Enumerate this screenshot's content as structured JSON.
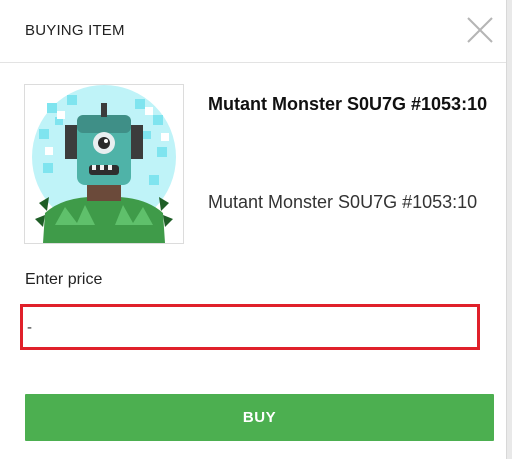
{
  "modal": {
    "title": "BUYING ITEM",
    "close_icon": "close-icon"
  },
  "item": {
    "name": "Mutant Monster S0U7G #1053:10",
    "description": "Mutant Monster S0U7G #1053:10",
    "image_icon": "mutant-monster-image"
  },
  "price": {
    "label": "Enter price",
    "value": "-"
  },
  "actions": {
    "buy_label": "BUY"
  },
  "colors": {
    "accent": "#4caf50",
    "input_border": "#e0202a"
  }
}
